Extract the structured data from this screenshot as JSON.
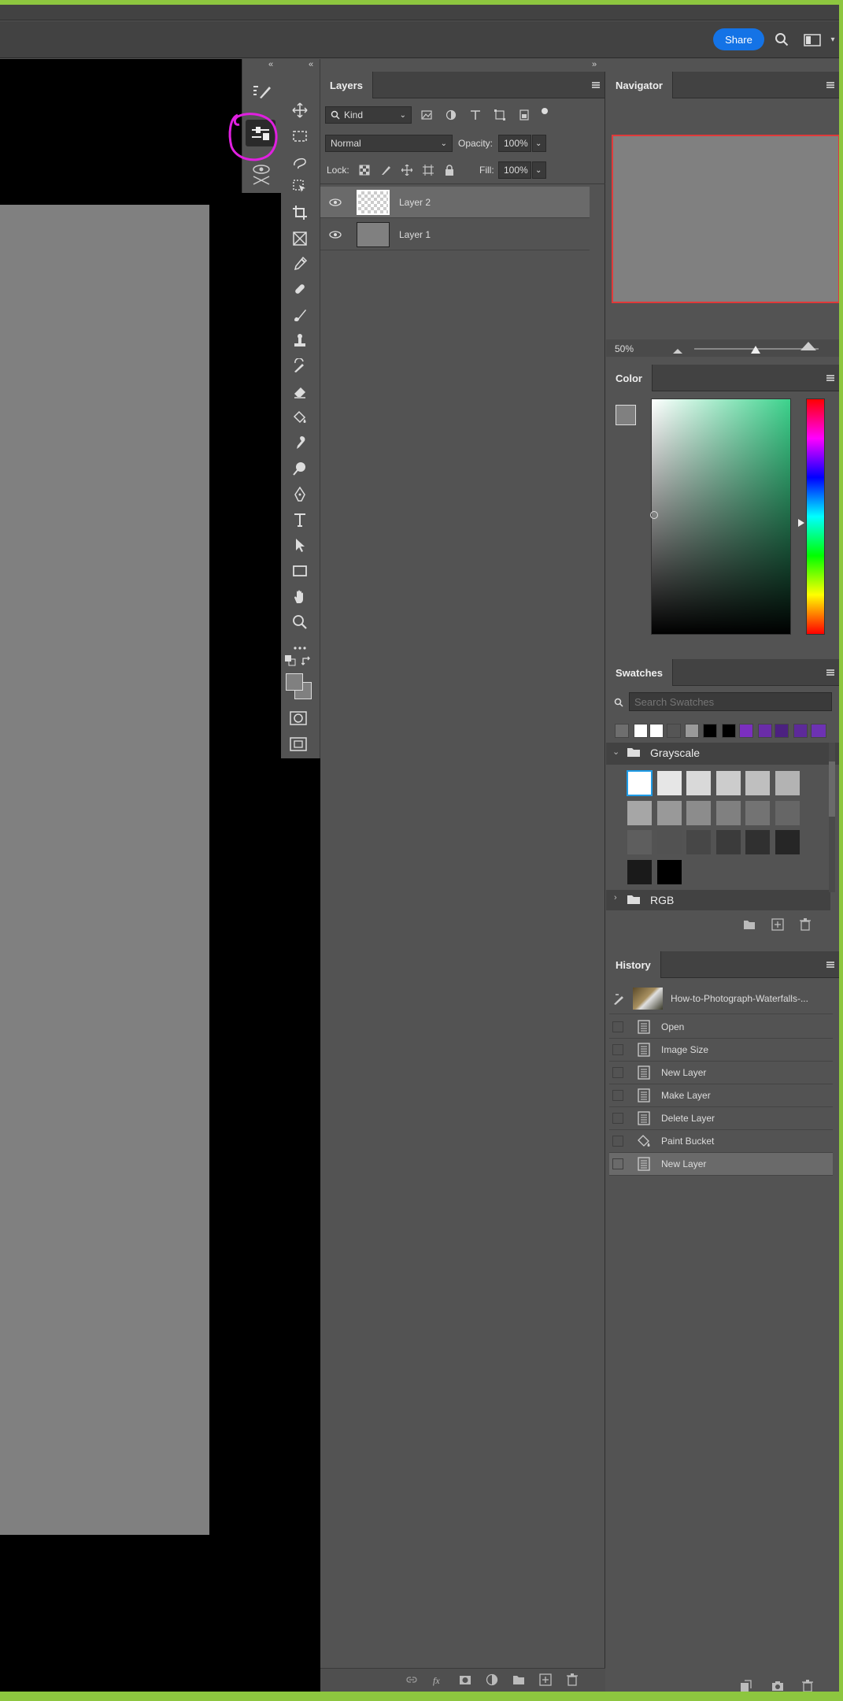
{
  "topbar": {
    "share_label": "Share"
  },
  "layers_panel": {
    "title": "Layers",
    "filter_kind": "Kind",
    "blend_mode": "Normal",
    "opacity_label": "Opacity:",
    "opacity_value": "100%",
    "lock_label": "Lock:",
    "fill_label": "Fill:",
    "fill_value": "100%",
    "layers": [
      {
        "name": "Layer 2",
        "selected": true
      },
      {
        "name": "Layer 1",
        "selected": false
      }
    ]
  },
  "navigator": {
    "title": "Navigator",
    "zoom": "50%"
  },
  "color": {
    "title": "Color"
  },
  "swatches": {
    "title": "Swatches",
    "search_placeholder": "Search Swatches",
    "recent": [
      "#6e6e6e",
      "#ffffff",
      "#ffffff",
      "#555555",
      "#9a9a9a",
      "#000000",
      "#000000",
      "#7b2fbf",
      "#6a2ca8",
      "#4c2180",
      "#5d2a99",
      "#6d32b3"
    ],
    "folders": [
      {
        "name": "Grayscale",
        "expanded": true
      },
      {
        "name": "RGB",
        "expanded": false
      }
    ],
    "grayscale": [
      "#ffffff",
      "#e6e6e6",
      "#d9d9d9",
      "#cccccc",
      "#bfbfbf",
      "#b3b3b3",
      "#a6a6a6",
      "#999999",
      "#8c8c8c",
      "#808080",
      "#737373",
      "#666666",
      "#5e5e5e",
      "#525252",
      "#474747",
      "#3b3b3b",
      "#303030",
      "#262626",
      "#1a1a1a",
      "#000000"
    ]
  },
  "history": {
    "title": "History",
    "snapshot": "How-to-Photograph-Waterfalls-...",
    "items": [
      {
        "label": "Open"
      },
      {
        "label": "Image Size"
      },
      {
        "label": "New Layer"
      },
      {
        "label": "Make Layer"
      },
      {
        "label": "Delete Layer"
      },
      {
        "label": "Paint Bucket"
      },
      {
        "label": "New Layer",
        "selected": true
      }
    ]
  },
  "colors": {
    "annotation": "#e020e0",
    "accent": "#1473e6",
    "frame": "#8dc63f"
  }
}
